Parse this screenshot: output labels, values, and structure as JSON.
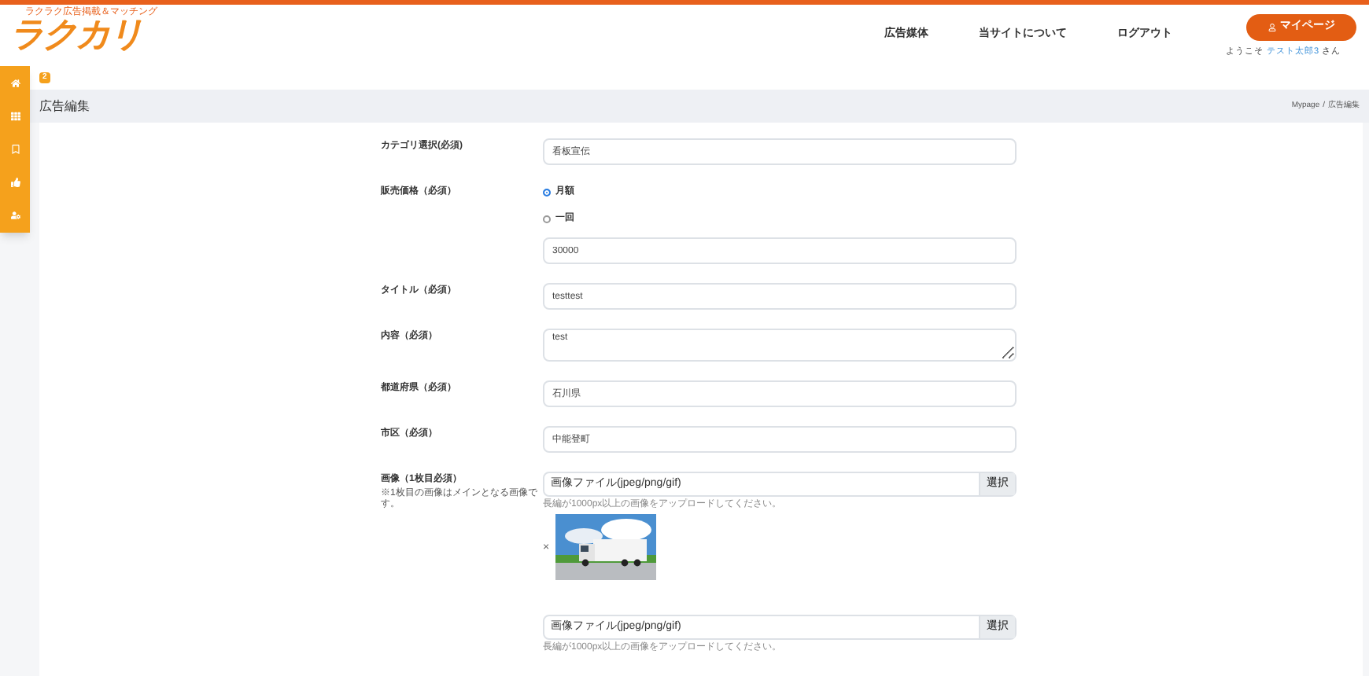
{
  "header": {
    "logo": "ラクカリ",
    "tagline": "ラクラク広告掲載＆マッチング",
    "nav": [
      "広告媒体",
      "当サイトについて",
      "ログアウト"
    ],
    "mypage_button": "マイページ",
    "welcome": {
      "prefix": "ようこそ",
      "user": "テスト太郎3",
      "suffix": "さん"
    }
  },
  "sidebar": {
    "items": [
      {
        "kind": "home",
        "selected": false
      },
      {
        "kind": "grid",
        "selected": false
      },
      {
        "kind": "bookmark",
        "selected": false
      },
      {
        "kind": "like",
        "selected": false
      },
      {
        "kind": "user",
        "selected": false
      }
    ]
  },
  "badge": "2",
  "page": {
    "title": "広告編集",
    "breadcrumb": [
      "Mypage",
      "/",
      "広告編集"
    ]
  },
  "form": [
    {
      "kind": "text",
      "label": "カテゴリ選択(必須)",
      "value": "看板宣伝"
    },
    {
      "kind": "price",
      "label": "販売価格（必須）",
      "options": [
        {
          "label": "月額",
          "selected": true
        },
        {
          "label": "一回",
          "selected": false
        }
      ],
      "value": "30000"
    },
    {
      "kind": "text",
      "label": "タイトル（必須）",
      "value": "testtest"
    },
    {
      "kind": "textarea",
      "label": "内容（必須）",
      "value": "test"
    },
    {
      "kind": "text",
      "label": "都道府県（必須）",
      "value": "石川県"
    },
    {
      "kind": "text",
      "label": "市区（必須）",
      "value": "中能登町"
    },
    {
      "kind": "images",
      "label": "画像（1枚目必須）",
      "note": "※1枚目の画像はメインとなる画像です。",
      "files": [
        {
          "placeholder": "画像ファイル(jpeg/png/gif)",
          "button": "選択",
          "hint": "長編が1000px以上の画像をアップロードしてください。",
          "preview": {
            "kind": "picture",
            "remove": "×"
          }
        },
        {
          "placeholder": "画像ファイル(jpeg/png/gif)",
          "button": "選択",
          "hint": "長編が1000px以上の画像をアップロードしてください。"
        }
      ]
    }
  ]
}
